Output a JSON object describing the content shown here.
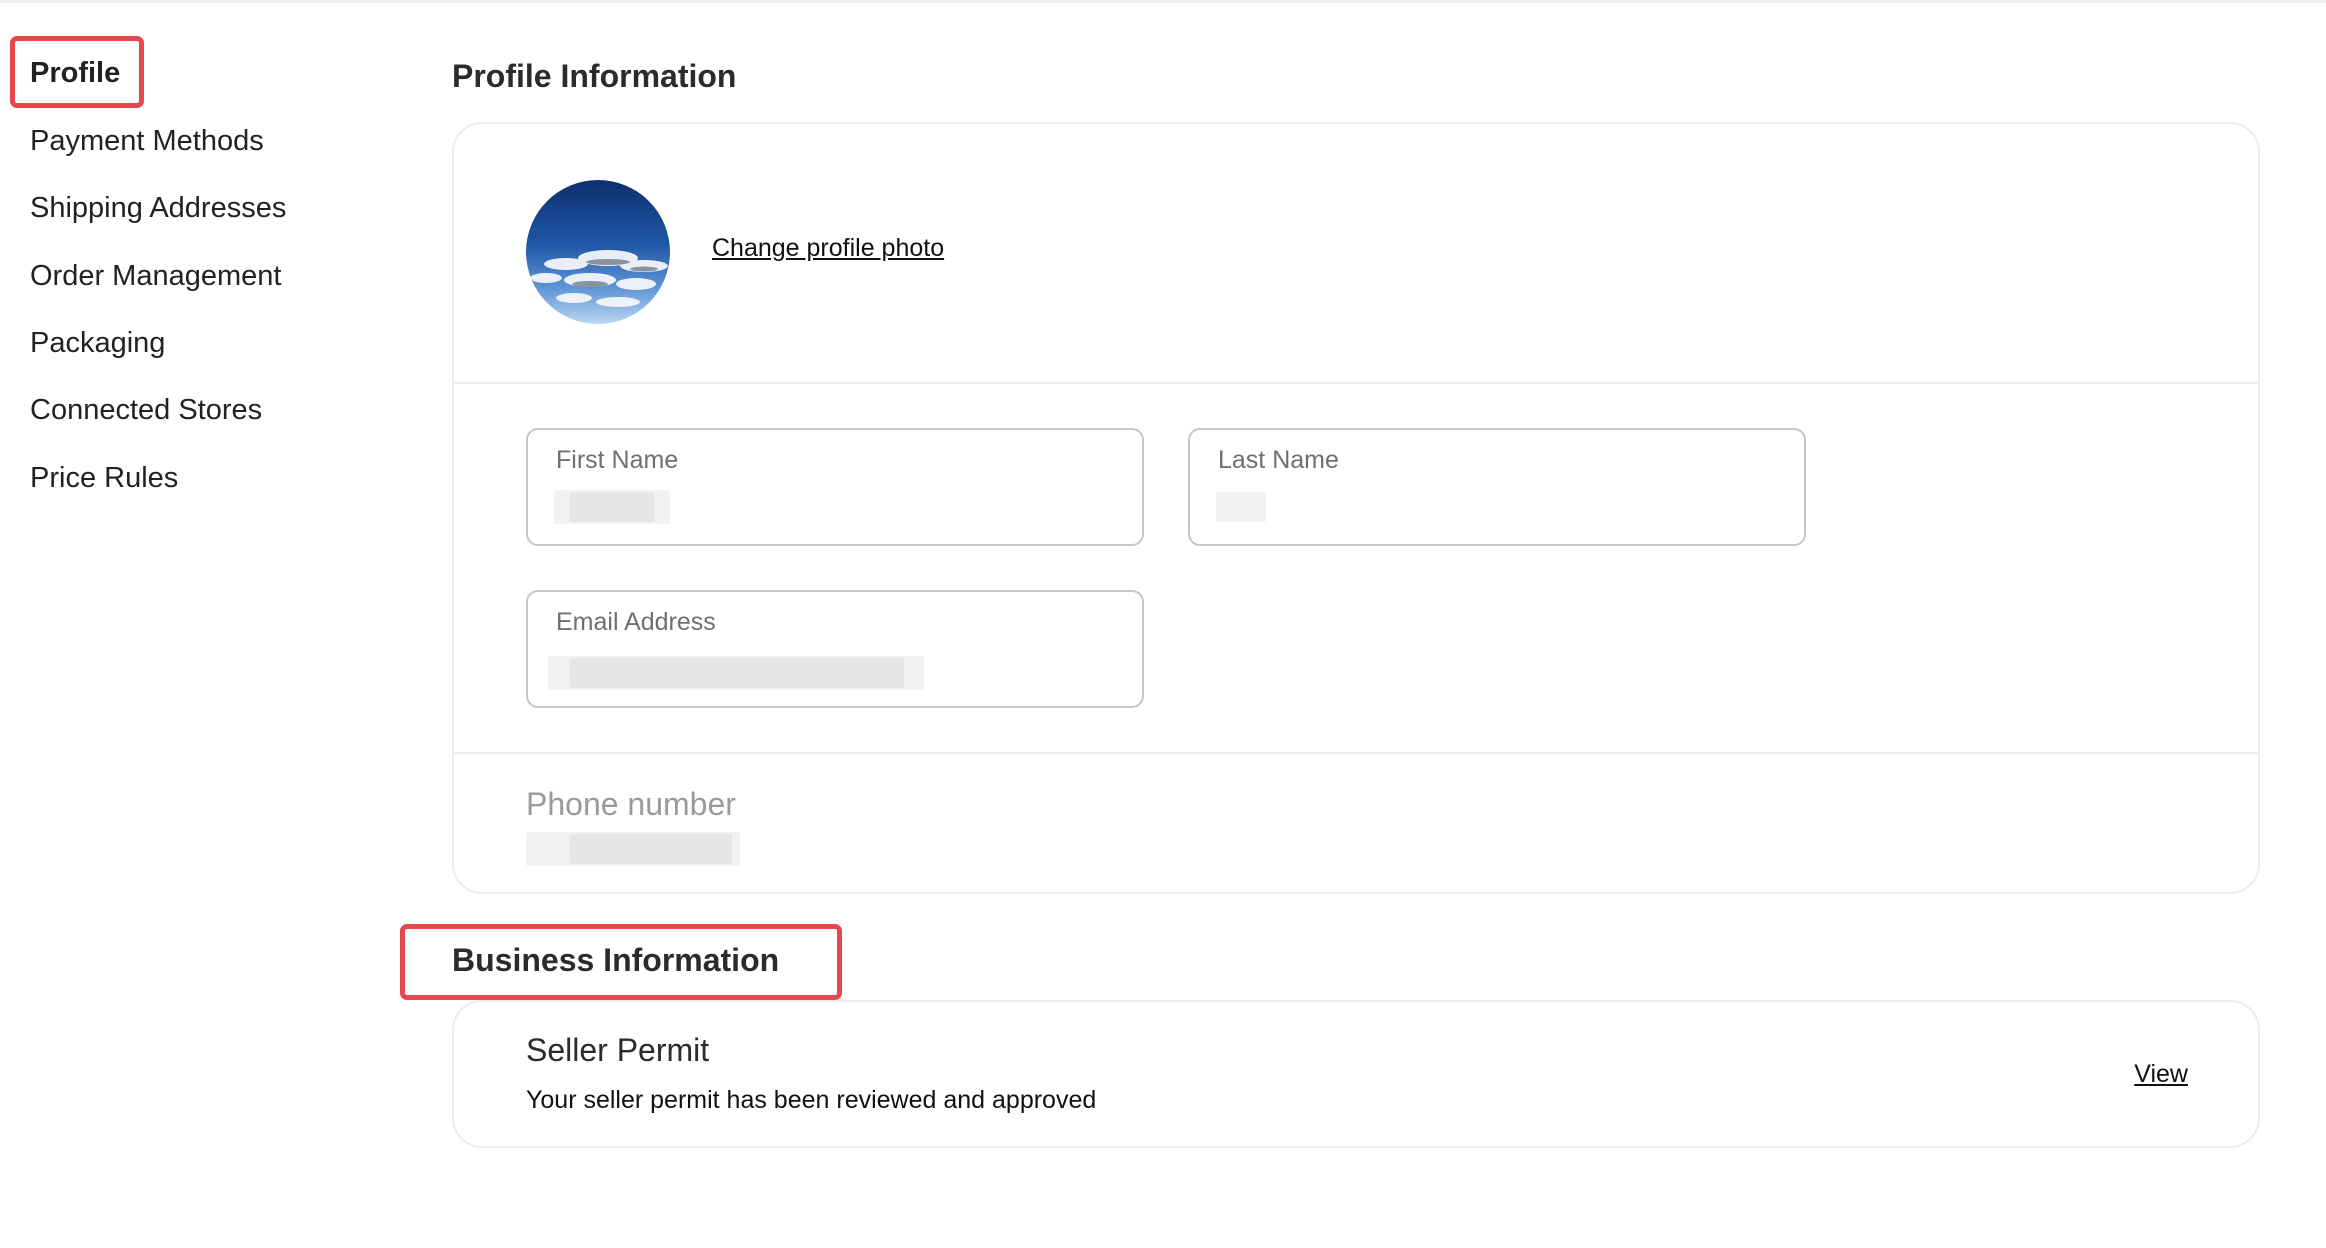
{
  "sidebar": {
    "items": [
      {
        "label": "Profile",
        "active": true
      },
      {
        "label": "Payment Methods",
        "active": false
      },
      {
        "label": "Shipping Addresses",
        "active": false
      },
      {
        "label": "Order Management",
        "active": false
      },
      {
        "label": "Packaging",
        "active": false
      },
      {
        "label": "Connected Stores",
        "active": false
      },
      {
        "label": "Price Rules",
        "active": false
      }
    ]
  },
  "profile": {
    "title": "Profile Information",
    "change_photo_label": "Change profile photo",
    "avatar_icon": "sky-clouds-photo",
    "fields": {
      "first_name": {
        "label": "First Name",
        "value": ""
      },
      "last_name": {
        "label": "Last Name",
        "value": ""
      },
      "email": {
        "label": "Email Address",
        "value": ""
      }
    },
    "phone": {
      "label": "Phone number",
      "value": ""
    }
  },
  "business": {
    "title": "Business Information",
    "seller_permit": {
      "title": "Seller Permit",
      "description": "Your seller permit has been reviewed and approved",
      "view_label": "View"
    }
  },
  "colors": {
    "highlight": "#e5484d",
    "card_border": "#ececec",
    "field_border": "#c6c6c6"
  }
}
